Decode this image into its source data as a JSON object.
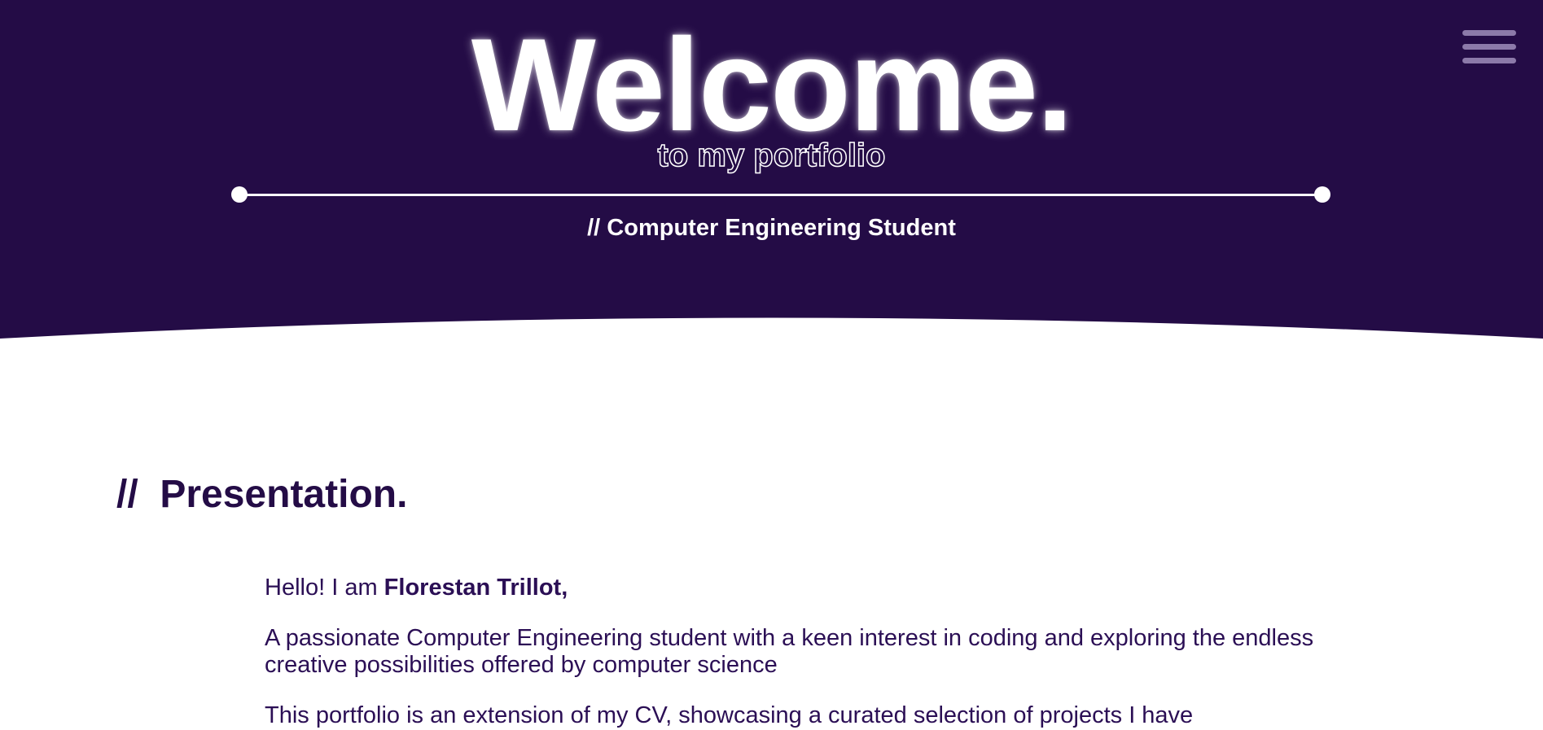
{
  "hero": {
    "title": "Welcome.",
    "subtitle": "to my portfolio",
    "role": "// Computer Engineering Student",
    "background_color": "#240c46"
  },
  "nav": {
    "menu_icon": "hamburger-menu-icon"
  },
  "presentation": {
    "heading_prefix": "//",
    "heading": "Presentation.",
    "greeting_prefix": "Hello! I am ",
    "name": "Florestan Trillot,",
    "paragraph1": "A passionate Computer Engineering student with a keen interest in coding and exploring the endless creative possibilities offered by computer science",
    "paragraph2": "This portfolio is an extension of my CV, showcasing a curated selection of projects I have"
  },
  "colors": {
    "primary": "#240c46",
    "text": "#2b0f55",
    "menu_icon": "#8c7aa9"
  }
}
